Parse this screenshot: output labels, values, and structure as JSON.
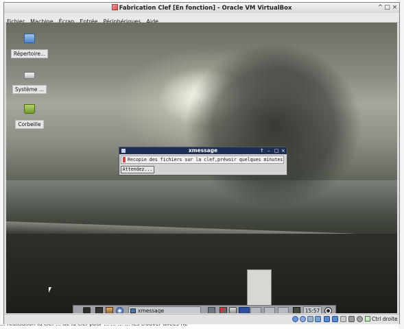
{
  "window": {
    "title": "Fabrication Clef [En fonction] - Oracle VM VirtualBox",
    "controls": [
      "^",
      "□",
      "×"
    ]
  },
  "menubar": {
    "items": [
      "Fichier",
      "Machine",
      "Écran",
      "Entrée",
      "Périphériques",
      "Aide"
    ]
  },
  "desktop": {
    "icons": [
      {
        "label": "Répertoire...",
        "icon": "folder-home-icon"
      },
      {
        "label": "Système ...",
        "icon": "drive-icon"
      },
      {
        "label": "Corbeille",
        "icon": "trash-icon"
      }
    ]
  },
  "xmessage": {
    "title": "xmessage",
    "controls": [
      "↑",
      "–",
      "□",
      "×"
    ],
    "message": "Recopie des fichiers sur la clef,prévoir quelques minutes.",
    "button": "Attendez..."
  },
  "taskbar": {
    "task_label": "xmessage",
    "clock": "15:57"
  },
  "statusbar": {
    "host_key": "Ctrl droite"
  },
  "background_text": {
    "bottom_line": "...  réalisation  la  clef ...  de  la  clef  pour  ...    ...  ...  ...  les  trouver allées ne"
  },
  "colors": {
    "xmessage_title": "#1e2f55",
    "taskbar": "#9ea2a8",
    "vbox_title": "#e6e6e6"
  }
}
